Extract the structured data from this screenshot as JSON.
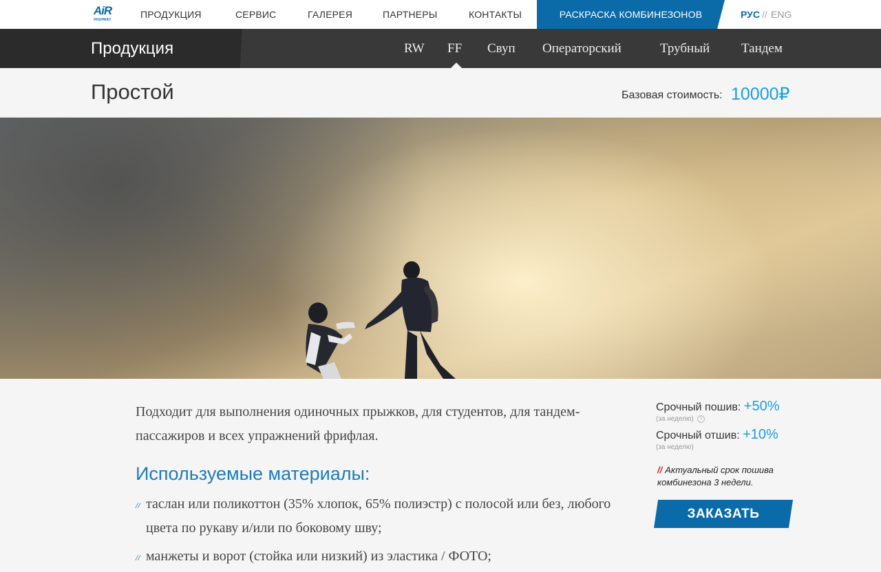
{
  "brand": {
    "logo_word": "AiR",
    "logo_sub": "HIGHWAY",
    "accent": "#0b6ba8",
    "price_color": "#1a9fe0"
  },
  "topnav": {
    "items": [
      "Продукция",
      "Сервис",
      "Галерея",
      "Партнеры",
      "Контакты"
    ],
    "cta": "Раскраска комбинезонов",
    "lang_active": "РУС",
    "lang_sep": "//",
    "lang_inactive": "ENG"
  },
  "subnav": {
    "title": "Продукция",
    "items": [
      "RW",
      "FF",
      "Свуп",
      "Операторский",
      "Трубный",
      "Тандем"
    ],
    "active": "FF"
  },
  "product": {
    "title": "Простой",
    "price_label": "Базовая стоимость:",
    "price_value": "10000₽"
  },
  "hero": {
    "alt_icon": "skydivers-photo"
  },
  "content": {
    "description": "Подходит для выполнения одиночных прыжков, для студентов, для тандем-пассажиров и всех упражнений фрифлая.",
    "materials_title": "Используемые материалы:",
    "materials": [
      "таслан или поликоттон (35% хлопок, 65% полиэстр) с полосой или без, любого цвета по рукаву и/или по боковому шву;",
      "манжеты и ворот (стойка или низкий) из эластика / ФОТО;"
    ],
    "bullet": "//"
  },
  "sidebar": {
    "rush_sew_label": "Срочный пошив:",
    "rush_sew_value": "+50%",
    "rush_sew_note": "(за неделю)",
    "rush_tailor_label": "Срочный отшив:",
    "rush_tailor_value": "+10%",
    "rush_tailor_note": "(за неделю)",
    "info_icon": "?",
    "notice_slashes": "//",
    "notice_text": "Актуальный срок пошива комбинезона 3 недели.",
    "order_button": "Заказать"
  }
}
